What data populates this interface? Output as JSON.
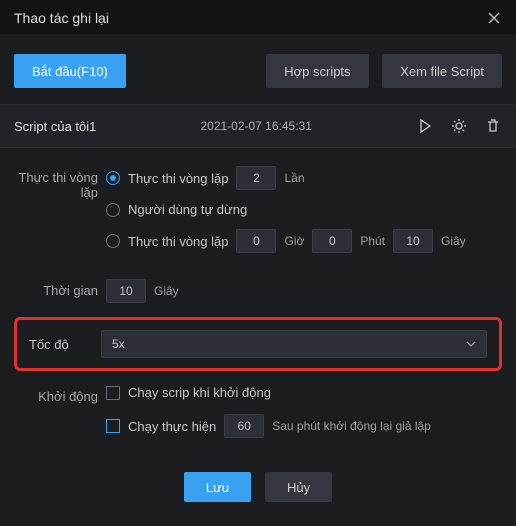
{
  "titlebar": {
    "title": "Thao tác ghi lại"
  },
  "top": {
    "start": "Bắt đầu(F10)",
    "merge": "Hợp scripts",
    "viewfile": "Xem file Script"
  },
  "script": {
    "name": "Script của tôi1",
    "date": "2021-02-07 16:45:31"
  },
  "loop": {
    "label": "Thực thi vòng lặp",
    "opt_count": "Thực thi vòng lặp",
    "count_value": "2",
    "count_unit": "Lần",
    "opt_user": "Người dùng tự dừng",
    "opt_time": "Thực thi vòng lặp",
    "h_value": "0",
    "h_unit": "Giờ",
    "m_value": "0",
    "m_unit": "Phút",
    "s_value": "10",
    "s_unit": "Giây"
  },
  "time": {
    "label": "Thời gian",
    "value": "10",
    "unit": "Giây"
  },
  "speed": {
    "label": "Tốc độ",
    "value": "5x"
  },
  "startup": {
    "label": "Khởi động",
    "run_on_start": "Chạy scrip khi khởi động",
    "run_after": "Chạy thực hiện",
    "after_value": "60",
    "after_suffix": "Sau phút khởi động lại giả lập"
  },
  "footer": {
    "save": "Lưu",
    "cancel": "Hủy"
  }
}
